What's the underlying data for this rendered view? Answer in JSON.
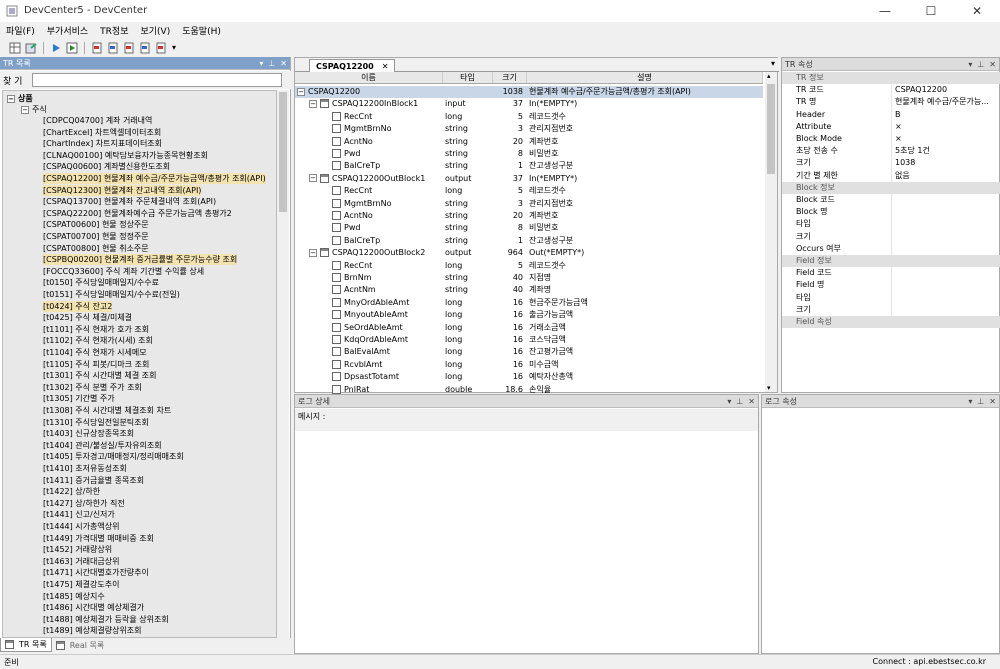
{
  "window": {
    "title": "DevCenter5 - DevCenter"
  },
  "menu": [
    "파일(F)",
    "부가서비스",
    "TR정보",
    "보기(V)",
    "도움말(H)"
  ],
  "left_panel": {
    "title": "TR 목록",
    "search_label": "찾 기",
    "search_value": "",
    "root": "상품",
    "child": "주식",
    "items": [
      {
        "text": "[CDPCQ04700] 계좌 거래내역",
        "hl": false
      },
      {
        "text": "[ChartExcel] 차트엑셀데이터조회",
        "hl": false
      },
      {
        "text": "[ChartIndex] 차트지표데이터조회",
        "hl": false
      },
      {
        "text": "[CLNAQ00100] 예탁담보융자가능종목현황조회",
        "hl": false
      },
      {
        "text": "[CSPAQ00600] 계좌별신용한도조회",
        "hl": false
      },
      {
        "text": "[CSPAQ12200] 현물계좌 예수금/주문가능금액/총평가 조회(API)",
        "hl": true
      },
      {
        "text": "[CSPAQ12300] 현물계좌 잔고내역 조회(API)",
        "hl": true
      },
      {
        "text": "[CSPAQ13700] 현물계좌 주문체결내역 조회(API)",
        "hl": false
      },
      {
        "text": "[CSPAQ22200] 현물계좌예수금 주문가능금액 총평가2",
        "hl": false
      },
      {
        "text": "[CSPAT00600] 현물 정상주문",
        "hl": false
      },
      {
        "text": "[CSPAT00700] 현물 정정주문",
        "hl": false
      },
      {
        "text": "[CSPAT00800] 현물 취소주문",
        "hl": false
      },
      {
        "text": "[CSPBQ00200] 현물계좌 증거금률별 주문가능수량 조회",
        "hl": true
      },
      {
        "text": "[FOCCQ33600] 주식 계좌 기간별 수익률 상세",
        "hl": false
      },
      {
        "text": "[t0150] 주식당일매매일지/수수료",
        "hl": false
      },
      {
        "text": "[t0151] 주식당일매매일지/수수료(전일)",
        "hl": false
      },
      {
        "text": "[t0424] 주식 잔고2",
        "hl": true
      },
      {
        "text": "[t0425] 주식 체결/미체결",
        "hl": false
      },
      {
        "text": "[t1101] 주식 현재가 호가 조회",
        "hl": false
      },
      {
        "text": "[t1102] 주식 현재가(시세) 조회",
        "hl": false
      },
      {
        "text": "[t1104] 주식 현재가 시세메모",
        "hl": false
      },
      {
        "text": "[t1105] 주식 피봇/디마크 조회",
        "hl": false
      },
      {
        "text": "[t1301] 주식 시간대별 체결 조회",
        "hl": false
      },
      {
        "text": "[t1302] 주식 분별 주가 조회",
        "hl": false
      },
      {
        "text": "[t1305] 기간별 주가",
        "hl": false
      },
      {
        "text": "[t1308] 주식 시간대별 체결조회 차트",
        "hl": false
      },
      {
        "text": "[t1310] 주식당일전일분틱조회",
        "hl": false
      },
      {
        "text": "[t1403] 신규상장종목조회",
        "hl": false
      },
      {
        "text": "[t1404] 관리/불성실/투자유의조회",
        "hl": false
      },
      {
        "text": "[t1405] 투자경고/매매정지/정리매매조회",
        "hl": false
      },
      {
        "text": "[t1410] 초저유동성조회",
        "hl": false
      },
      {
        "text": "[t1411] 증거금율별 종목조회",
        "hl": false
      },
      {
        "text": "[t1422] 상/하한",
        "hl": false
      },
      {
        "text": "[t1427] 상/하한가 직전",
        "hl": false
      },
      {
        "text": "[t1441] 신고/신저가",
        "hl": false
      },
      {
        "text": "[t1444] 시가총액상위",
        "hl": false
      },
      {
        "text": "[t1449] 가격대별 매매비중 조회",
        "hl": false
      },
      {
        "text": "[t1452] 거래량상위",
        "hl": false
      },
      {
        "text": "[t1463] 거래대금상위",
        "hl": false
      },
      {
        "text": "[t1471] 시간대별호가잔량추이",
        "hl": false
      },
      {
        "text": "[t1475] 체결강도추이",
        "hl": false
      },
      {
        "text": "[t1485] 예상지수",
        "hl": false
      },
      {
        "text": "[t1486] 시간대별 예상체결가",
        "hl": false
      },
      {
        "text": "[t1488] 예상체결가 등락율 상위조회",
        "hl": false
      },
      {
        "text": "[t1489] 예상체결량상위조회",
        "hl": false
      }
    ],
    "tabs": [
      "TR 목록",
      "Real 목록"
    ]
  },
  "center": {
    "tab_label": "CSPAQ12200",
    "columns": [
      "이름",
      "타입",
      "크기",
      "설명"
    ],
    "rows": [
      {
        "lvl": 0,
        "kind": "root",
        "name": "CSPAQ12200",
        "type": "",
        "size": "1038",
        "desc": "현물계좌 예수금/주문가능금액/총평가 조회(API)",
        "sel": true
      },
      {
        "lvl": 1,
        "kind": "block",
        "name": "CSPAQ12200InBlock1",
        "type": "input",
        "size": "37",
        "desc": "In(*EMPTY*)"
      },
      {
        "lvl": 2,
        "kind": "field",
        "name": "RecCnt",
        "type": "long",
        "size": "5",
        "desc": "레코드갯수"
      },
      {
        "lvl": 2,
        "kind": "field",
        "name": "MgmtBrnNo",
        "type": "string",
        "size": "3",
        "desc": "관리지점번호"
      },
      {
        "lvl": 2,
        "kind": "field",
        "name": "AcntNo",
        "type": "string",
        "size": "20",
        "desc": "계좌번호"
      },
      {
        "lvl": 2,
        "kind": "field",
        "name": "Pwd",
        "type": "string",
        "size": "8",
        "desc": "비밀번호"
      },
      {
        "lvl": 2,
        "kind": "field",
        "name": "BalCreTp",
        "type": "string",
        "size": "1",
        "desc": "잔고생성구분"
      },
      {
        "lvl": 1,
        "kind": "block",
        "name": "CSPAQ12200OutBlock1",
        "type": "output",
        "size": "37",
        "desc": "In(*EMPTY*)"
      },
      {
        "lvl": 2,
        "kind": "field",
        "name": "RecCnt",
        "type": "long",
        "size": "5",
        "desc": "레코드갯수"
      },
      {
        "lvl": 2,
        "kind": "field",
        "name": "MgmtBrnNo",
        "type": "string",
        "size": "3",
        "desc": "관리지점번호"
      },
      {
        "lvl": 2,
        "kind": "field",
        "name": "AcntNo",
        "type": "string",
        "size": "20",
        "desc": "계좌번호"
      },
      {
        "lvl": 2,
        "kind": "field",
        "name": "Pwd",
        "type": "string",
        "size": "8",
        "desc": "비밀번호"
      },
      {
        "lvl": 2,
        "kind": "field",
        "name": "BalCreTp",
        "type": "string",
        "size": "1",
        "desc": "잔고생성구분"
      },
      {
        "lvl": 1,
        "kind": "block",
        "name": "CSPAQ12200OutBlock2",
        "type": "output",
        "size": "964",
        "desc": "Out(*EMPTY*)"
      },
      {
        "lvl": 2,
        "kind": "field",
        "name": "RecCnt",
        "type": "long",
        "size": "5",
        "desc": "레코드갯수"
      },
      {
        "lvl": 2,
        "kind": "field",
        "name": "BrnNm",
        "type": "string",
        "size": "40",
        "desc": "지점명"
      },
      {
        "lvl": 2,
        "kind": "field",
        "name": "AcntNm",
        "type": "string",
        "size": "40",
        "desc": "계좌명"
      },
      {
        "lvl": 2,
        "kind": "field",
        "name": "MnyOrdAbleAmt",
        "type": "long",
        "size": "16",
        "desc": "현금주문가능금액"
      },
      {
        "lvl": 2,
        "kind": "field",
        "name": "MnyoutAbleAmt",
        "type": "long",
        "size": "16",
        "desc": "출금가능금액"
      },
      {
        "lvl": 2,
        "kind": "field",
        "name": "SeOrdAbleAmt",
        "type": "long",
        "size": "16",
        "desc": "거래소금액"
      },
      {
        "lvl": 2,
        "kind": "field",
        "name": "KdqOrdAbleAmt",
        "type": "long",
        "size": "16",
        "desc": "코스닥금액"
      },
      {
        "lvl": 2,
        "kind": "field",
        "name": "BalEvalAmt",
        "type": "long",
        "size": "16",
        "desc": "잔고평가금액"
      },
      {
        "lvl": 2,
        "kind": "field",
        "name": "RcvblAmt",
        "type": "long",
        "size": "16",
        "desc": "미수금액"
      },
      {
        "lvl": 2,
        "kind": "field",
        "name": "DpsastTotamt",
        "type": "long",
        "size": "16",
        "desc": "예탁자산총액"
      },
      {
        "lvl": 2,
        "kind": "field",
        "name": "PnlRat",
        "type": "double",
        "size": "18.6",
        "desc": "손익율"
      }
    ]
  },
  "log_detail": {
    "title": "로그 상세",
    "message_label": "메시지 :"
  },
  "log_attr": {
    "title": "로그 속성"
  },
  "props": {
    "title": "TR 속성",
    "rows": [
      {
        "cat": "TR 정보"
      },
      {
        "k": "TR 코드",
        "v": "CSPAQ12200"
      },
      {
        "k": "TR 명",
        "v": "현물계좌 예수금/주문가능..."
      },
      {
        "k": "Header",
        "v": "B"
      },
      {
        "k": "Attribute",
        "v": "×"
      },
      {
        "k": "Block Mode",
        "v": "×"
      },
      {
        "k": "초당 전송 수",
        "v": "5초당 1건"
      },
      {
        "k": "크기",
        "v": "1038"
      },
      {
        "k": "기간 별 제한",
        "v": "없음"
      },
      {
        "cat": "Block 정보"
      },
      {
        "k": "Block 코드",
        "v": ""
      },
      {
        "k": "Block 명",
        "v": ""
      },
      {
        "k": "타입",
        "v": ""
      },
      {
        "k": "크기",
        "v": ""
      },
      {
        "k": "Occurs 여부",
        "v": ""
      },
      {
        "cat": "Field 정보"
      },
      {
        "k": "Field 코드",
        "v": ""
      },
      {
        "k": "Field 명",
        "v": ""
      },
      {
        "k": "타입",
        "v": ""
      },
      {
        "k": "크기",
        "v": ""
      },
      {
        "cat": "Field 속성"
      }
    ]
  },
  "status": {
    "left": "준비",
    "right": "Connect : api.ebestsec.co.kr"
  }
}
